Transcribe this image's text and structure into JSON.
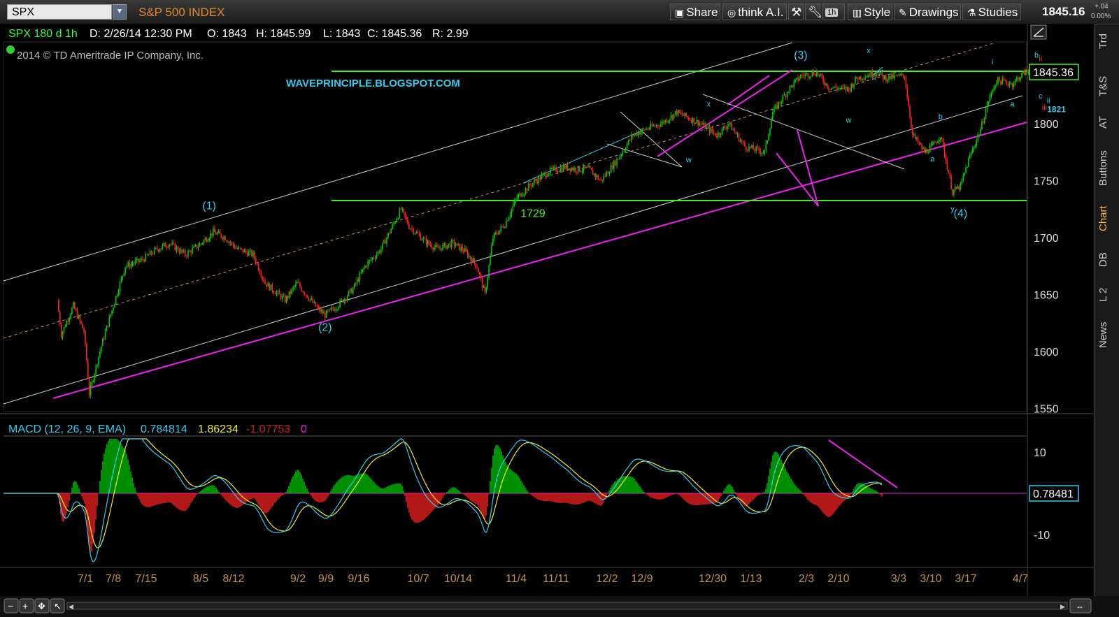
{
  "toolbar": {
    "symbol": "SPX",
    "description": "S&P 500 INDEX",
    "buttons": [
      {
        "label": "Share",
        "icon": "share-icon"
      },
      {
        "label": "think A.I.",
        "icon": "think-ai-icon"
      },
      {
        "label": "",
        "icon": "drawing-tools-icon"
      },
      {
        "label": "",
        "icon": "wrench-icon"
      },
      {
        "label": "1h",
        "icon": "aggregation-period"
      },
      {
        "label": "Style",
        "icon": "style-icon"
      },
      {
        "label": "Drawings",
        "icon": "pencil-icon"
      },
      {
        "label": "Studies",
        "icon": "studies-icon"
      }
    ],
    "last_price": "1845.16",
    "change": "+.04",
    "change_pct": "0.00%"
  },
  "header": {
    "title": "SPX 180 d 1h",
    "date": "D: 2/26/14 12:30 PM",
    "open": "O: 1843",
    "high": "H: 1845.99",
    "low": "L: 1843",
    "close": "C: 1845.36",
    "range": "R: 2.99",
    "copyright": "2014 © TD Ameritrade IP Company, Inc."
  },
  "watermark": "WAVEPRINCIPLE.BLOGSPOT.COM",
  "right_tabs": [
    "Trd",
    "T&S",
    "AT",
    "Buttons",
    "Chart",
    "DB",
    "L 2",
    "News"
  ],
  "colors": {
    "up": "#00cc00",
    "down": "#ff2222",
    "green_line": "#44ee22",
    "magenta": "#ee22ee",
    "cyan": "#33ccee",
    "axis_text": "#c09050",
    "macd_line": "#33ccee",
    "signal_line": "#eeee33"
  },
  "chart_data": [
    {
      "type": "candlestick",
      "title": "SPX 180 d 1h",
      "ylim": [
        1550,
        1845
      ],
      "y_ticks": [
        1550,
        1600,
        1650,
        1700,
        1750,
        1800
      ],
      "x_ticks": [
        "7/1",
        "7/8",
        "7/15",
        "8/5",
        "8/12",
        "9/2",
        "9/9",
        "9/16",
        "10/7",
        "10/14",
        "11/4",
        "11/11",
        "12/2",
        "12/9",
        "12/30",
        "1/13",
        "2/3",
        "2/10",
        "3/3",
        "3/10",
        "3/17",
        "4/7"
      ],
      "price_path": [
        [
          "6/24",
          1645
        ],
        [
          "6/25",
          1615
        ],
        [
          "6/28",
          1640
        ],
        [
          "7/1",
          1615
        ],
        [
          "7/1",
          1607
        ],
        [
          "7/2",
          1563
        ],
        [
          "7/5",
          1605
        ],
        [
          "7/8",
          1640
        ],
        [
          "7/11",
          1675
        ],
        [
          "7/15",
          1680
        ],
        [
          "7/19",
          1690
        ],
        [
          "7/22",
          1695
        ],
        [
          "7/26",
          1685
        ],
        [
          "7/30",
          1695
        ],
        [
          "8/2",
          1705
        ],
        [
          "8/5",
          1700
        ],
        [
          "8/8",
          1690
        ],
        [
          "8/12",
          1685
        ],
        [
          "8/15",
          1660
        ],
        [
          "8/20",
          1645
        ],
        [
          "8/23",
          1660
        ],
        [
          "8/28",
          1638
        ],
        [
          "8/30",
          1632
        ],
        [
          "9/2",
          1640
        ],
        [
          "9/6",
          1655
        ],
        [
          "9/9",
          1675
        ],
        [
          "9/13",
          1690
        ],
        [
          "9/18",
          1725
        ],
        [
          "9/20",
          1710
        ],
        [
          "9/24",
          1697
        ],
        [
          "9/27",
          1690
        ],
        [
          "10/1",
          1695
        ],
        [
          "10/4",
          1688
        ],
        [
          "10/7",
          1675
        ],
        [
          "10/9",
          1650
        ],
        [
          "10/11",
          1700
        ],
        [
          "10/14",
          1712
        ],
        [
          "10/17",
          1735
        ],
        [
          "10/21",
          1748
        ],
        [
          "10/25",
          1758
        ],
        [
          "10/29",
          1762
        ],
        [
          "11/1",
          1760
        ],
        [
          "11/4",
          1760
        ],
        [
          "11/7",
          1750
        ],
        [
          "11/11",
          1768
        ],
        [
          "11/15",
          1790
        ],
        [
          "11/18",
          1795
        ],
        [
          "11/22",
          1800
        ],
        [
          "11/26",
          1810
        ],
        [
          "11/29",
          1805
        ],
        [
          "12/2",
          1800
        ],
        [
          "12/6",
          1790
        ],
        [
          "12/9",
          1800
        ],
        [
          "12/13",
          1780
        ],
        [
          "12/18",
          1775
        ],
        [
          "12/20",
          1810
        ],
        [
          "12/24",
          1830
        ],
        [
          "12/27",
          1842
        ],
        [
          "12/31",
          1845
        ],
        [
          "1/3",
          1832
        ],
        [
          "1/8",
          1830
        ],
        [
          "1/10",
          1840
        ],
        [
          "1/15",
          1845
        ],
        [
          "1/17",
          1840
        ],
        [
          "1/22",
          1842
        ],
        [
          "1/24",
          1790
        ],
        [
          "1/27",
          1775
        ],
        [
          "1/29",
          1780
        ],
        [
          "1/31",
          1790
        ],
        [
          "2/3",
          1740
        ],
        [
          "2/5",
          1745
        ],
        [
          "2/7",
          1768
        ],
        [
          "2/10",
          1795
        ],
        [
          "2/12",
          1820
        ],
        [
          "2/14",
          1838
        ],
        [
          "2/18",
          1835
        ],
        [
          "2/21",
          1845
        ],
        [
          "2/24",
          1848
        ],
        [
          "2/26",
          1845.36
        ]
      ],
      "horizontal_lines": [
        {
          "label": "1729",
          "value": 1729
        },
        {
          "label": "1845.36",
          "value": 1845.36
        }
      ],
      "current_price_label": "1845.36",
      "wave_labels": [
        {
          "text": "(1)",
          "x": "8/1",
          "y": 1725,
          "color": "cyan"
        },
        {
          "text": "(2)",
          "x": "8/30",
          "y": 1618,
          "color": "cyan"
        },
        {
          "text": "(3)",
          "x": "12/27",
          "y": 1857,
          "color": "cyan"
        },
        {
          "text": "(4)",
          "x": "2/5",
          "y": 1718,
          "color": "cyan"
        },
        {
          "text": "x",
          "x": "12/4",
          "y": 1815,
          "color": "cyan"
        },
        {
          "text": "w",
          "x": "11/29",
          "y": 1766,
          "color": "cyan"
        },
        {
          "text": "x",
          "x": "1/13",
          "y": 1862,
          "color": "cyan"
        },
        {
          "text": "w",
          "x": "1/8",
          "y": 1801,
          "color": "cyan"
        },
        {
          "text": "a",
          "x": "1/29",
          "y": 1767,
          "color": "cyan"
        },
        {
          "text": "b",
          "x": "1/31",
          "y": 1804,
          "color": "cyan"
        },
        {
          "text": "y",
          "x": "2/3",
          "y": 1723,
          "color": "cyan"
        },
        {
          "text": "i",
          "x": "2/13",
          "y": 1852,
          "color": "cyan"
        },
        {
          "text": "a",
          "x": "2/18",
          "y": 1815,
          "color": "cyan"
        },
        {
          "text": "b",
          "x": "2/24",
          "y": 1858,
          "color": "cyan"
        },
        {
          "text": "ii",
          "x": "2/25",
          "y": 1855,
          "color": "red"
        },
        {
          "text": "ii",
          "x": "2/25",
          "y": 1838,
          "color": "cyan"
        },
        {
          "text": "c",
          "x": "2/25",
          "y": 1822,
          "color": "cyan"
        },
        {
          "text": "ii",
          "x": "2/27",
          "y": 1818,
          "color": "cyan"
        },
        {
          "text": "iii",
          "x": "2/26",
          "y": 1812,
          "color": "red"
        },
        {
          "text": "1821",
          "x": "3/1",
          "y": 1810,
          "color": "cyan"
        },
        {
          "text": "1729",
          "x": "10/21",
          "y": 1718,
          "color": "green"
        }
      ]
    },
    {
      "type": "line",
      "title": "MACD (12, 26, 9, EMA)",
      "series": [
        {
          "name": "MACD",
          "value": "0.784814"
        },
        {
          "name": "Avg",
          "value": "1.86234"
        },
        {
          "name": "Diff",
          "value": "-1.07753"
        },
        {
          "name": "ZeroLine",
          "value": "0"
        }
      ],
      "ylim": [
        -16,
        14
      ],
      "y_ticks": [
        -10,
        10
      ],
      "current_label": "0.78481"
    }
  ]
}
